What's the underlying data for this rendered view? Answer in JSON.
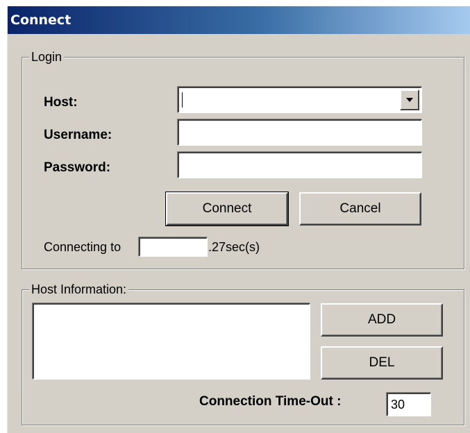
{
  "window": {
    "title": "Connect"
  },
  "login": {
    "group_label": "Login",
    "host_label": "Host:",
    "host_value": "",
    "username_label": "Username:",
    "username_value": "",
    "password_label": "Password:",
    "password_value": "",
    "connect_label": "Connect",
    "cancel_label": "Cancel",
    "status_prefix": "Connecting to",
    "status_host": "",
    "status_suffix": ".27sec(s)"
  },
  "host_info": {
    "group_label": "Host Information:",
    "add_label": "ADD",
    "del_label": "DEL",
    "timeout_label": "Connection Time-Out :",
    "timeout_value": "30",
    "hosts": []
  },
  "icons": {
    "combo_dropdown": "chevron-down-icon"
  }
}
